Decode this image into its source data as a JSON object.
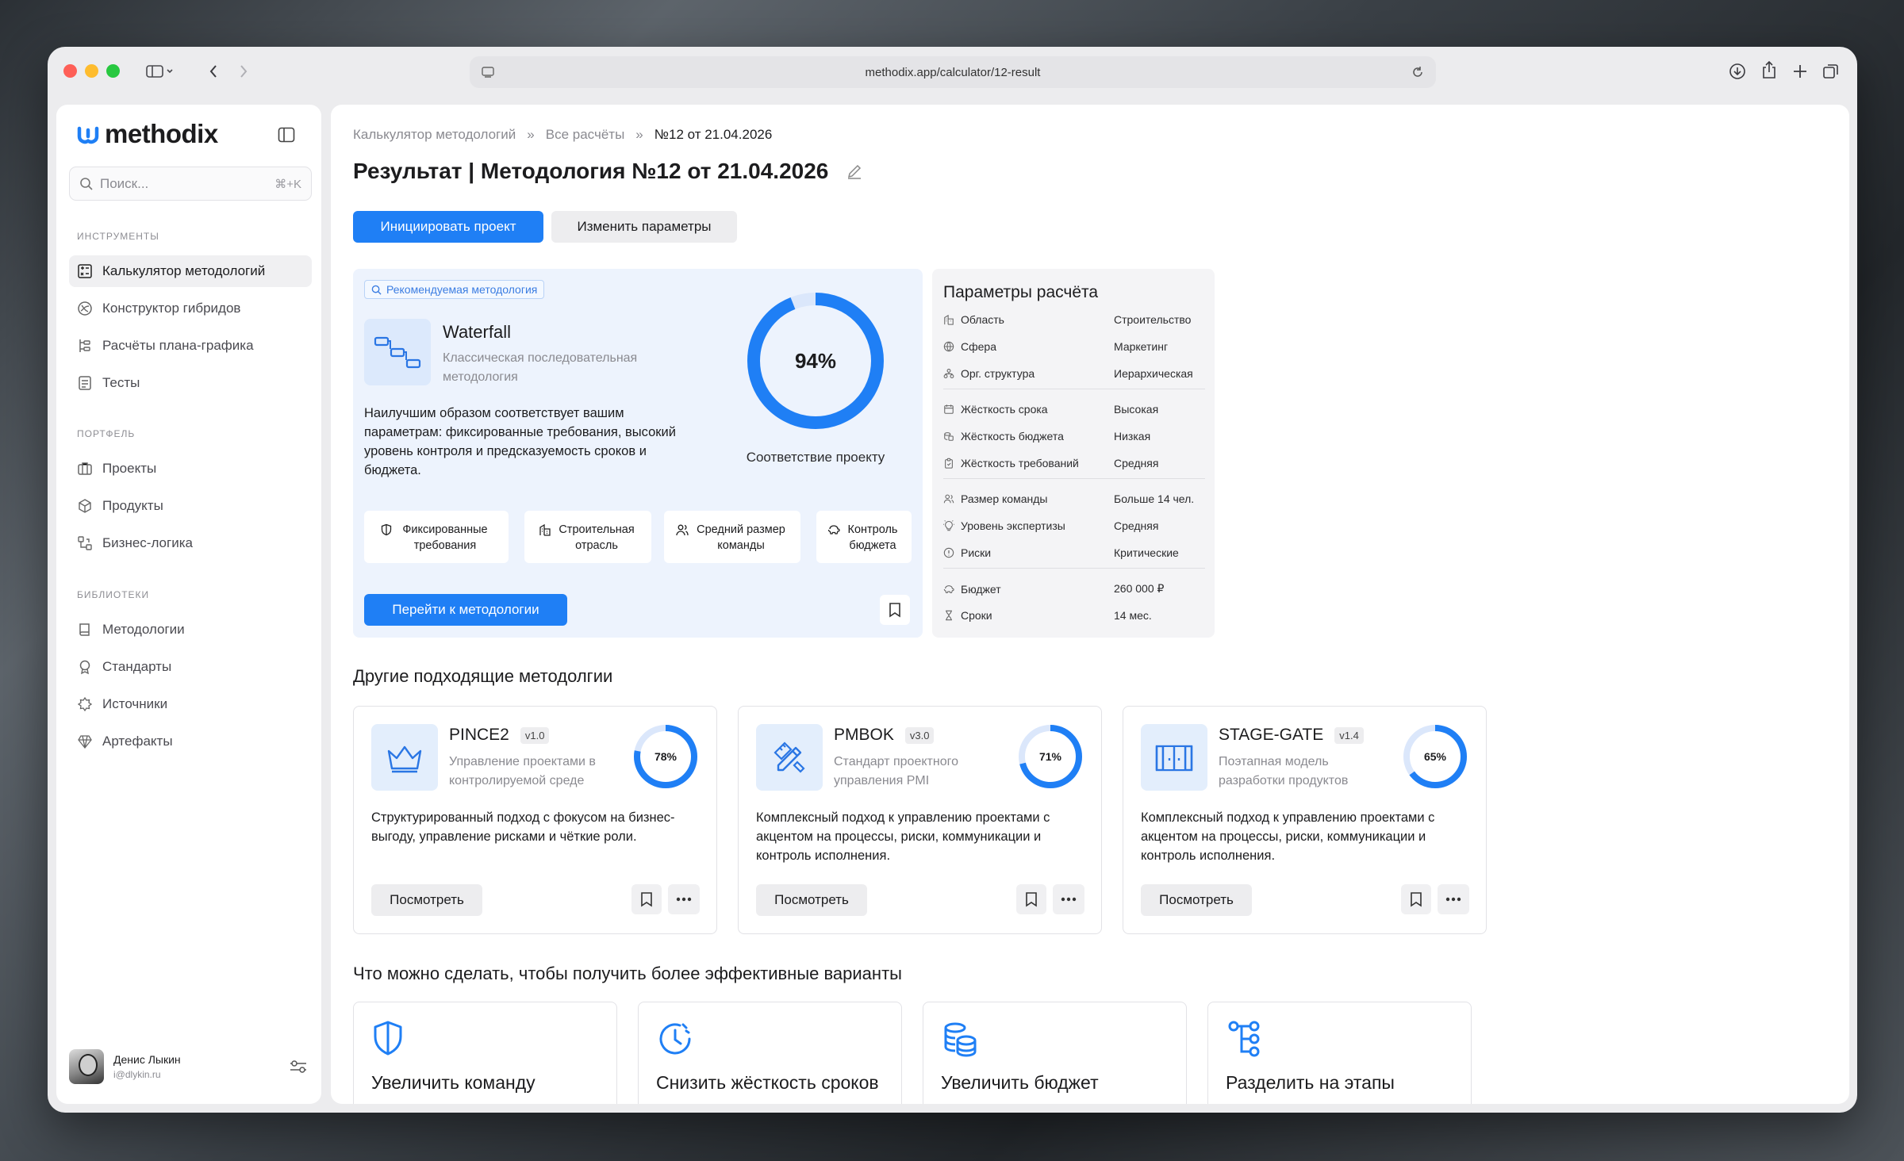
{
  "browser": {
    "url": "methodix.app/calculator/12-result"
  },
  "sidebar": {
    "brand": "methodix",
    "search_placeholder": "Поиск...",
    "search_shortcut": "⌘+K",
    "sections": {
      "tools": "ИНСТРУМЕНТЫ",
      "portfolio": "ПОРТФЕЛЬ",
      "libraries": "БИБЛИОТЕКИ"
    },
    "items": {
      "calculator": "Калькулятор методологий",
      "hybrid": "Конструктор гибридов",
      "schedule": "Расчёты плана-графика",
      "tests": "Тесты",
      "projects": "Проекты",
      "products": "Продукты",
      "logic": "Бизнес-логика",
      "methodologies": "Методологии",
      "standards": "Стандарты",
      "sources": "Источники",
      "artifacts": "Артефакты"
    },
    "user": {
      "name": "Денис Лыкин",
      "email": "i@dlykin.ru"
    }
  },
  "breadcrumb": {
    "b1": "Калькулятор методологий",
    "b2": "Все расчёты",
    "b3": "№12 от 21.04.2026",
    "sep": "»"
  },
  "page": {
    "title": "Результат | Методология №12 от 21.04.2026",
    "btn_initiate": "Инициировать проект",
    "btn_change": "Изменить параметры"
  },
  "recommended": {
    "tag": "Рекомендуемая методология",
    "name": "Waterfall",
    "subtitle": "Классическая последовательная методология",
    "description": "Наилучшим образом соответствует вашим параметрам: фиксированные требования, высокий уровень контроля и предсказуемость сроков и бюджета.",
    "match_label": "94%",
    "match_value": 0.94,
    "match_caption": "Соответствие проекту",
    "chips": {
      "c1": "Фиксированные требования",
      "c2": "Строительная отрасль",
      "c3": "Средний размер команды",
      "c4": "Контроль бюджета"
    },
    "goto": "Перейти к методологии"
  },
  "params": {
    "title": "Параметры расчёта",
    "rows": [
      {
        "key": "Область",
        "value": "Строительство",
        "icon": "building-icon"
      },
      {
        "key": "Сфера",
        "value": "Маркетинг",
        "icon": "globe-icon"
      },
      {
        "key": "Орг. структура",
        "value": "Иерархическая",
        "icon": "org-icon"
      },
      {
        "key": "Жёсткость срока",
        "value": "Высокая",
        "icon": "calendar-icon"
      },
      {
        "key": "Жёсткость бюджета",
        "value": "Низкая",
        "icon": "coins-icon"
      },
      {
        "key": "Жёсткость требований",
        "value": "Средняя",
        "icon": "clipboard-icon"
      },
      {
        "key": "Размер команды",
        "value": "Больше 14 чел.",
        "icon": "team-icon"
      },
      {
        "key": "Уровень экспертизы",
        "value": "Средняя",
        "icon": "bulb-icon"
      },
      {
        "key": "Риски",
        "value": "Критические",
        "icon": "alert-icon"
      },
      {
        "key": "Бюджет",
        "value": "260 000 ₽",
        "icon": "piggy-icon"
      },
      {
        "key": "Сроки",
        "value": "14 мес.",
        "icon": "hourglass-icon"
      }
    ]
  },
  "others": {
    "heading": "Другие подходящие методолгии",
    "view_label": "Посмотреть",
    "cards": [
      {
        "name": "PINCE2",
        "version": "v1.0",
        "subtitle": "Управление проектами в контролируемой среде",
        "match_label": "78%",
        "match_value": 0.78,
        "description": "Структурированный подход с фокусом на бизнес-выгоду, управление рисками и чёткие роли.",
        "icon": "crown-icon"
      },
      {
        "name": "PMBOK",
        "version": "v3.0",
        "subtitle": "Стандарт проектного управления PMI",
        "match_label": "71%",
        "match_value": 0.71,
        "description": "Комплексный подход к управлению проектами с акцентом на процессы, риски, коммуникации и контроль исполнения.",
        "icon": "pencil-ruler-icon"
      },
      {
        "name": "STAGE-GATE",
        "version": "v1.4",
        "subtitle": "Поэтапная модель разработки продуктов",
        "match_label": "65%",
        "match_value": 0.65,
        "description": "Комплексный подход к управлению проектами с акцентом на процессы, риски, коммуникации и контроль исполнения.",
        "icon": "gate-icon"
      }
    ]
  },
  "improve": {
    "heading": "Что можно сделать, чтобы получить более эффективные варианты",
    "actions": [
      {
        "label": "Увеличить команду",
        "icon": "shield-icon"
      },
      {
        "label": "Снизить жёсткость сроков",
        "icon": "clock-icon"
      },
      {
        "label": "Увеличить бюджет",
        "icon": "coins-stack-icon"
      },
      {
        "label": "Разделить на этапы",
        "icon": "tree-icon"
      }
    ]
  },
  "colors": {
    "accent": "#1f7ff5",
    "accent_light": "#edf3fd"
  }
}
